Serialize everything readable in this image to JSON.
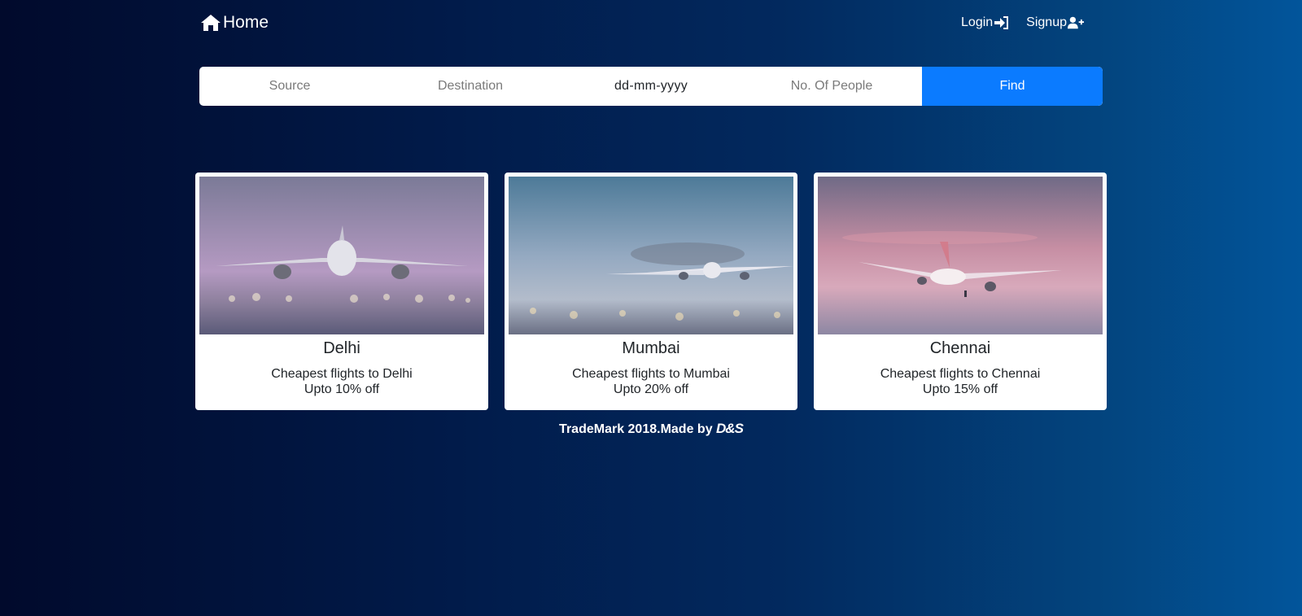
{
  "nav": {
    "home_label": "Home",
    "home_icon": "home-icon",
    "login_label": "Login",
    "login_icon": "sign-in-icon",
    "signup_label": "Signup",
    "signup_icon": "user-plus-icon"
  },
  "search": {
    "source_placeholder": "Source",
    "destination_placeholder": "Destination",
    "date_value": "dd-mm-yyyy",
    "people_placeholder": "No. Of People",
    "find_label": "Find"
  },
  "colors": {
    "accent": "#0b7bff",
    "background_start": "#010a2c",
    "background_end": "#02559b"
  },
  "cards": [
    {
      "title": "Delhi",
      "line1": "Cheapest flights to Delhi",
      "line2": "Upto 10% off"
    },
    {
      "title": "Mumbai",
      "line1": "Cheapest flights to Mumbai",
      "line2": "Upto 20% off"
    },
    {
      "title": "Chennai",
      "line1": "Cheapest flights to Chennai",
      "line2": "Upto 15% off"
    }
  ],
  "footer": {
    "text": "TradeMark 2018.Made by ",
    "brand": "D&S"
  }
}
